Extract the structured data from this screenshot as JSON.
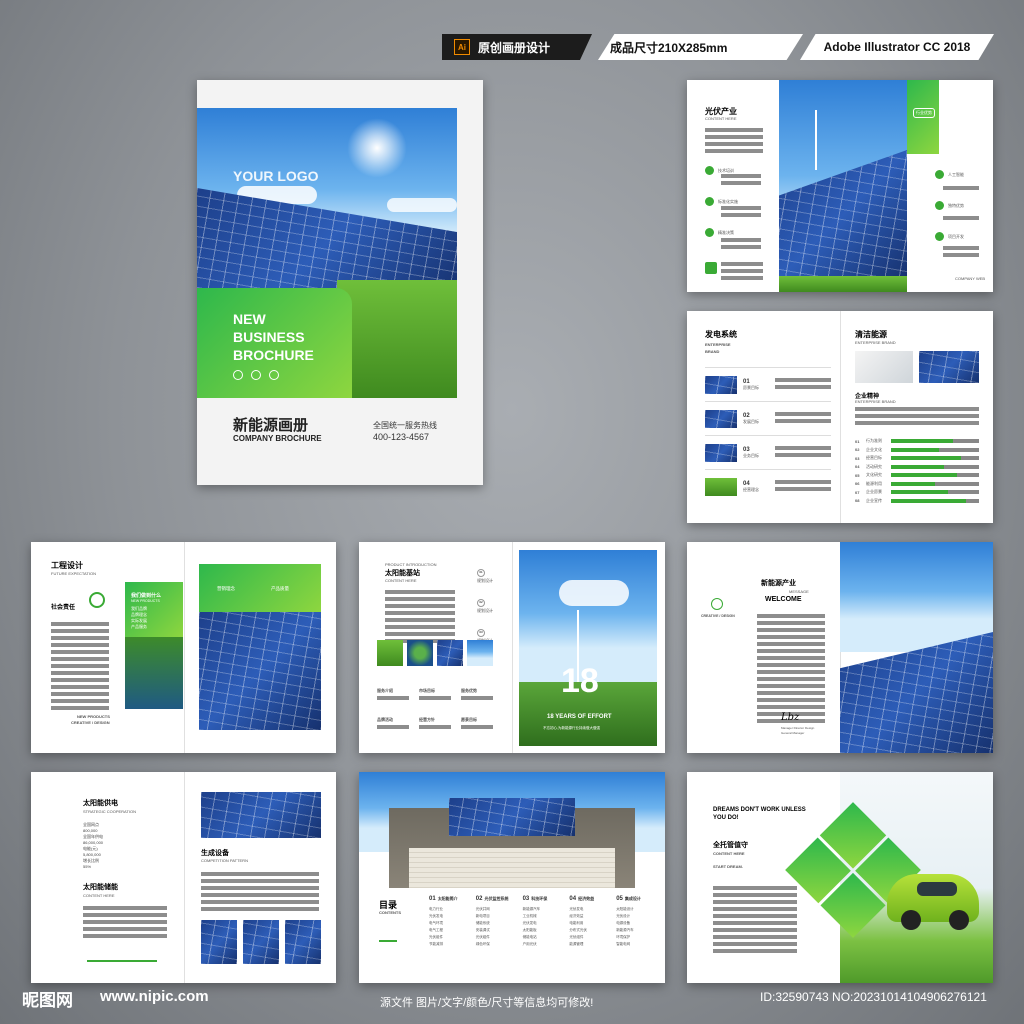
{
  "header": {
    "ai_badge": "Ai",
    "tag1": "原创画册设计",
    "tag2": "成品尺寸210X285mm",
    "tag3": "Adobe Illustrator CC 2018"
  },
  "cover": {
    "logo": "YOUR LOGO",
    "headline": [
      "NEW",
      "BUSINESS",
      "BROCHURE"
    ],
    "title_cn": "新能源画册",
    "title_en": "COMPANY BROCHURE",
    "hotline_label": "全国统一服务热线",
    "hotline_number": "400-123-4567"
  },
  "p1": {
    "title": "光伏产业",
    "subtitle": "CONTENT HERE",
    "items_left": [
      "技术培训",
      "标准化实施",
      "精准决策"
    ],
    "badge": "行业优势",
    "items_right": [
      "人工智能",
      "独特优势",
      "项目开发"
    ],
    "footer": "COMPANY WEB"
  },
  "p2": {
    "title_left": "发电系统",
    "sub_left": [
      "ENTERPRISE",
      "BRAND"
    ],
    "rows": [
      {
        "num": "01",
        "label": "愿景目标"
      },
      {
        "num": "02",
        "label": "发展目标"
      },
      {
        "num": "03",
        "label": "业务目标"
      },
      {
        "num": "04",
        "label": "经营理念"
      }
    ],
    "title_right": "清洁能源",
    "sub_right": "ENTERPRISE BRAND",
    "spirit_title": "企业精神",
    "spirit_sub": "ENTERPRISE BRAND",
    "bars": [
      {
        "num": "01",
        "label": "行为准则",
        "value": 0.7
      },
      {
        "num": "02",
        "label": "企业文化",
        "value": 0.55
      },
      {
        "num": "03",
        "label": "经营目标",
        "value": 0.8
      },
      {
        "num": "04",
        "label": "活动研究",
        "value": 0.6
      },
      {
        "num": "05",
        "label": "文化研究",
        "value": 0.75
      },
      {
        "num": "06",
        "label": "能源利用",
        "value": 0.5
      },
      {
        "num": "07",
        "label": "企业愿景",
        "value": 0.65
      },
      {
        "num": "08",
        "label": "企业宣传",
        "value": 0.85
      }
    ]
  },
  "p3": {
    "title": "工程设计",
    "subtitle": "FUTURE EXPECTATION",
    "section": "社会责任",
    "green_title": "我们做到什么",
    "green_sub": "NEW PRODUCTS",
    "green_items": [
      "我们品牌",
      "品牌理念",
      "实际发展",
      "产品服务"
    ],
    "foot1": "NEW PRODUCTS",
    "foot2": "CREATIVE / DESIGN",
    "banner_items": [
      "营销理念",
      "产品质量"
    ]
  },
  "p4": {
    "small": "PRODUCT INTRODUCTION",
    "title": "太阳能基站",
    "subtitle": "CONTENT HERE",
    "nums": [
      {
        "n": "01",
        "t": "规划设计"
      },
      {
        "n": "02",
        "t": "规划设计"
      },
      {
        "n": "03",
        "t": "规划设计"
      }
    ],
    "labels": [
      "服务介绍",
      "市场目标",
      "服务优势",
      "品牌活动",
      "经营方针",
      "愿景目标"
    ],
    "big_number": "18",
    "years": "18 YEARS OF EFFORT",
    "caption": "不忘初心,为新能源行业持续做大做强"
  },
  "p5": {
    "title": "新能源产业",
    "message": "MESSAGE",
    "welcome": "WELCOME",
    "creative": "CREATIVE / DESIGN",
    "signature": "Lbz",
    "sign_name": "Manager Director Design",
    "sign_title": "General Manager"
  },
  "p6": {
    "title1": "太阳能供电",
    "sub1": "STRATEGIC COOPERATION",
    "stats": [
      "全国网点",
      "800,000",
      "全国年供电",
      "86,000,000",
      "电能(元)",
      "5,800,000",
      "增长比例",
      "55%"
    ],
    "title2": "太阳能储能",
    "sub2": "CONTENT HERE",
    "title3": "生成设备",
    "sub3": "COMPETITION PATTERN"
  },
  "p7": {
    "toc_title": "目录",
    "toc_sub": "CONTENTS",
    "cols": [
      {
        "n": "01",
        "t": "太阳能简介",
        "items": [
          "电力行业",
          "光伏发电",
          "电气环境",
          "电气工程",
          "光伏组件",
          "节能减排"
        ]
      },
      {
        "n": "02",
        "t": "光伏监控系统",
        "items": [
          "光伏并网",
          "新电项目",
          "储能系统",
          "安装调试",
          "光伏组件",
          "绿色环保"
        ]
      },
      {
        "n": "03",
        "t": "科技环保",
        "items": [
          "新能源汽车",
          "工业机械",
          "光伏发电",
          "太阳能板",
          "储能电站",
          "户用光伏"
        ]
      },
      {
        "n": "04",
        "t": "经济效益",
        "items": [
          "光伏发电",
          "经济效益",
          "电能利用",
          "分布式光伏",
          "光伏组件",
          "能源管理"
        ]
      },
      {
        "n": "05",
        "t": "集成设计",
        "items": [
          "太阳能设计",
          "光伏设计",
          "电源设备",
          "新能源汽车",
          "环境保护",
          "智能电网"
        ]
      }
    ]
  },
  "p8": {
    "title_en": "DREAMS DON'T WORK UNLESS YOU DO!",
    "title_cn": "全托管值守",
    "sub": "CONTENT HERE",
    "start": "START DREAM."
  },
  "footer": {
    "logo": "昵图网",
    "url": "www.nipic.com",
    "notice": "源文件 图片/文字/颜色/尺寸等信息均可修改!",
    "id": "ID:32590743 NO:20231014104906276121"
  }
}
